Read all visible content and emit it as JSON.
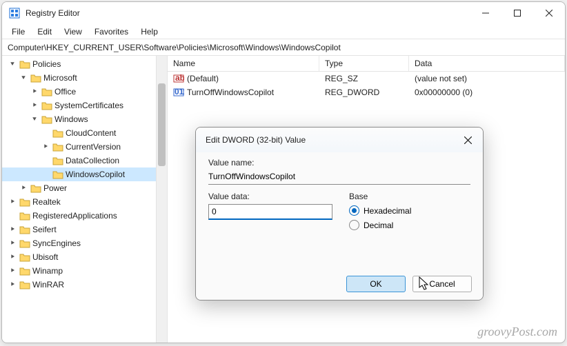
{
  "titlebar": {
    "title": "Registry Editor"
  },
  "menu": {
    "file": "File",
    "edit": "Edit",
    "view": "View",
    "favorites": "Favorites",
    "help": "Help"
  },
  "pathbar": "Computer\\HKEY_CURRENT_USER\\Software\\Policies\\Microsoft\\Windows\\WindowsCopilot",
  "tree": {
    "policies": "Policies",
    "microsoft": "Microsoft",
    "office": "Office",
    "systemcerts": "SystemCertificates",
    "windows": "Windows",
    "cloudcontent": "CloudContent",
    "currentversion": "CurrentVersion",
    "datacollection": "DataCollection",
    "windowscopilot": "WindowsCopilot",
    "power": "Power",
    "realtek": "Realtek",
    "regapps": "RegisteredApplications",
    "seifert": "Seifert",
    "syncengines": "SyncEngines",
    "ubisoft": "Ubisoft",
    "winamp": "Winamp",
    "winrar": "WinRAR"
  },
  "list": {
    "headers": {
      "name": "Name",
      "type": "Type",
      "data": "Data"
    },
    "rows": [
      {
        "name": "(Default)",
        "type": "REG_SZ",
        "data": "(value not set)",
        "icon": "sz"
      },
      {
        "name": "TurnOffWindowsCopilot",
        "type": "REG_DWORD",
        "data": "0x00000000 (0)",
        "icon": "dword"
      }
    ]
  },
  "dialog": {
    "title": "Edit DWORD (32-bit) Value",
    "valuename_label": "Value name:",
    "valuename": "TurnOffWindowsCopilot",
    "valuedata_label": "Value data:",
    "valuedata": "0",
    "base_label": "Base",
    "hex": "Hexadecimal",
    "dec": "Decimal",
    "ok": "OK",
    "cancel": "Cancel"
  },
  "watermark": "groovyPost.com"
}
